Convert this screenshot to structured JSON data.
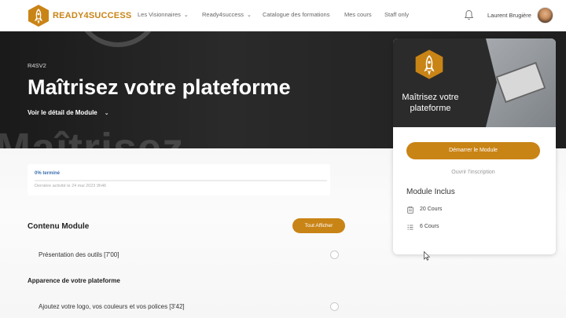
{
  "brand": {
    "name": "READY4SUCCESS",
    "color": "#c98416"
  },
  "nav": {
    "items": [
      {
        "label": "Les Visionnaires",
        "dropdown": true
      },
      {
        "label": "Ready4success",
        "dropdown": true
      },
      {
        "label": "Catalogue des formations",
        "dropdown": false
      },
      {
        "label": "Mes cours",
        "dropdown": false
      },
      {
        "label": "Staff only",
        "dropdown": false
      }
    ],
    "user_name": "Laurent Brugière"
  },
  "hero": {
    "code": "R4SV2",
    "title": "Maîtrisez votre plateforme",
    "detail_link": "Voir le détail de Module",
    "background_text": "Maîtrisez"
  },
  "progress": {
    "label": "0% terminé",
    "value": 0,
    "last_activity": "Dernière activité le 24 mai 2023 9h46"
  },
  "content": {
    "title": "Contenu Module",
    "show_all_label": "Tout Afficher",
    "lessons": [
      {
        "title": "Présentation des outils [7'00]"
      }
    ],
    "groups": [
      {
        "title": "Apparence de votre plateforme",
        "lessons": [
          {
            "title": "Ajoutez votre logo, vos couleurs et vos polices [3'42]"
          }
        ]
      }
    ]
  },
  "side_card": {
    "thumbnail_title": "Maîtrisez votre plateforme",
    "start_button": "Démarrer le Module",
    "open_registration": "Ouvrir l'inscription",
    "includes_title": "Module Inclus",
    "stats": [
      {
        "icon": "clipboard-icon",
        "label": "20 Cours"
      },
      {
        "icon": "quiz-list-icon",
        "label": "6 Cours"
      }
    ]
  }
}
